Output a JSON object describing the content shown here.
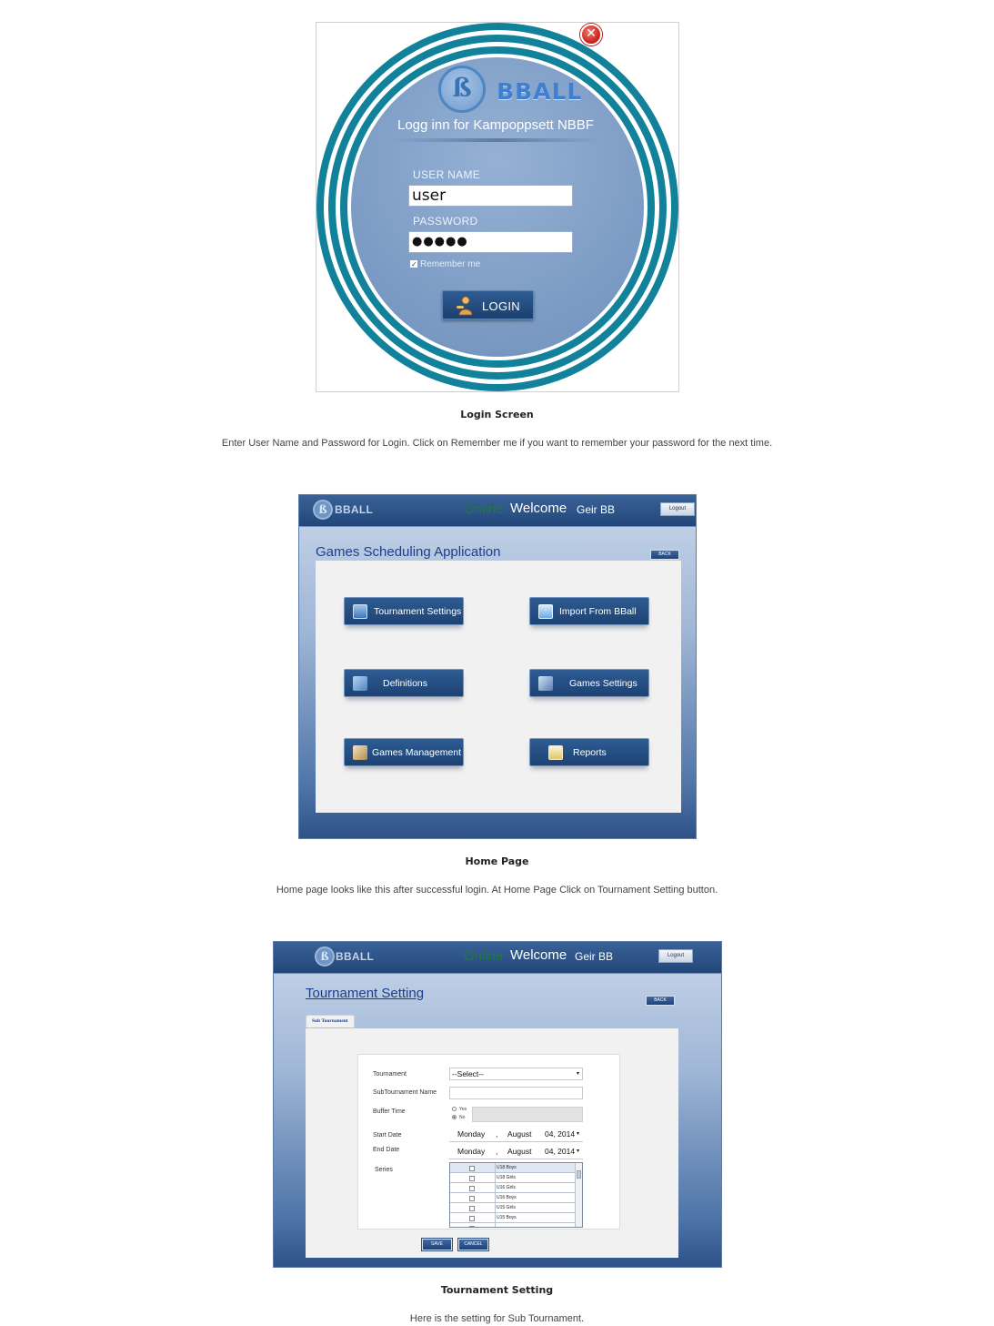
{
  "login": {
    "close_glyph": "✕",
    "brand": "BBALL",
    "logo_glyph": "ß",
    "heading": "Logg inn for Kampoppsett NBBF",
    "username_label": "USER NAME",
    "username_value": "user",
    "password_label": "PASSWORD",
    "password_value": "●●●●●",
    "remember_label": "Remember me",
    "remember_checked": true,
    "login_button": "LOGIN",
    "colors": {
      "ring": "#11829a",
      "disc": "#7f9ec6",
      "button": "#23497a"
    },
    "caption": "Login Screen",
    "description": "Enter User Name and Password for Login. Click on Remember me if you want to remember your password for the next time."
  },
  "home": {
    "brand": "BBALL",
    "online": "Online",
    "welcome": "Welcome",
    "user": "Geir BB",
    "logout": "Logout",
    "title": "Games Scheduling Application",
    "back": "BACK",
    "buttons": [
      {
        "label": "Tournament Settings",
        "icon": "settings-gear-icon"
      },
      {
        "label": "Import From BBall",
        "icon": "import-icon"
      },
      {
        "label": "Definitions",
        "icon": "definitions-icon"
      },
      {
        "label": "Games Settings",
        "icon": "games-settings-icon"
      },
      {
        "label": "Games Management",
        "icon": "games-management-icon"
      },
      {
        "label": "Reports",
        "icon": "reports-icon"
      }
    ],
    "caption": "Home Page",
    "description": "Home page looks like this after successful login. At Home Page Click on Tournament Setting button."
  },
  "tournament": {
    "brand": "BBALL",
    "online": "Online",
    "welcome": "Welcome",
    "user": "Geir BB",
    "logout": "Logout",
    "title": "Tournament Setting",
    "back": "BACK",
    "tab": "Sub Tournament",
    "form": {
      "tournament_label": "Tournament",
      "tournament_value": "--Select--",
      "subtournament_label": "SubTournament Name",
      "subtournament_value": "",
      "buffer_label": "Buffer Time",
      "buffer_yes": "Yes",
      "buffer_no": "No",
      "buffer_selected": "No",
      "start_label": "Start Date",
      "start_day": "Monday",
      "start_month": "August",
      "start_date": "04, 2014",
      "end_label": "End Date",
      "end_day": "Monday",
      "end_month": "August",
      "end_date": "04, 2014",
      "series_label": "Series",
      "series": [
        "U18 Boys",
        "U18 Girls",
        "U16 Girls",
        "U16 Boys",
        "U15 Girls",
        "U15 Boys"
      ]
    },
    "save": "SAVE",
    "cancel": "CANCEL",
    "caption": "Tournament Setting",
    "description": "Here is the setting for Sub Tournament."
  }
}
